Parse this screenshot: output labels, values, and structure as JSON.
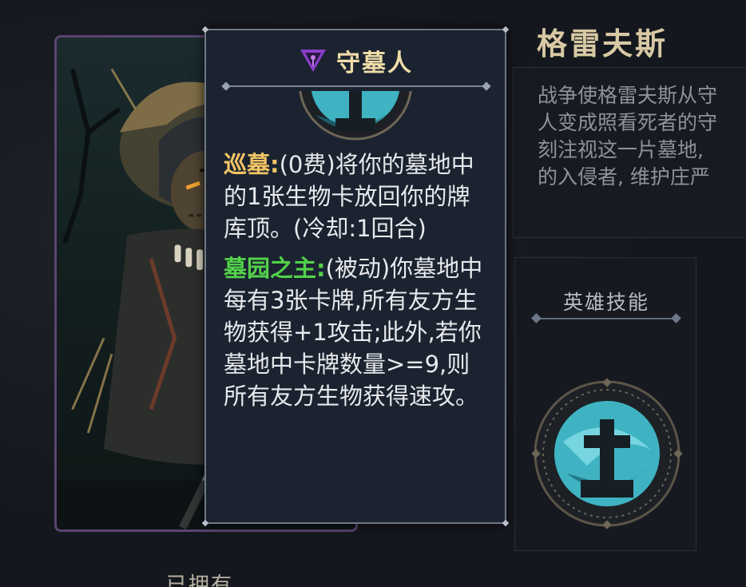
{
  "hero": {
    "name": "格雷夫斯",
    "lore": "战争使格雷夫斯从守\n人变成照看死者的守\n刻注视这一片墓地,\n的入侵者, 维护庄严",
    "owned_label": "已拥有"
  },
  "skill_panel": {
    "title": "英雄技能",
    "icon": "grave-cross-icon"
  },
  "tooltip": {
    "class_icon": "graveyard-class-icon",
    "class_name": "守墓人",
    "abilities": [
      {
        "keyword": "巡墓:",
        "keyword_color": "#f2c466",
        "text": "(0费)将你的墓地中的1张生物卡放回你的牌库顶。(冷却:1回合)"
      },
      {
        "keyword": "墓园之主:",
        "keyword_color": "#53d14b",
        "text": "(被动)你墓地中每有3张卡牌,所有友方生物获得+1攻击;此外,若你墓地中卡牌数量>=9,则所有友方生物获得速攻。"
      }
    ]
  },
  "colors": {
    "card_border": "#5b4570",
    "tooltip_bg": "#1b2330",
    "hero_name": "#d8c9a4",
    "medal_teal": "#3fb3c2"
  }
}
